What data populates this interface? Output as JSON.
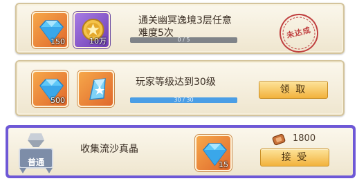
{
  "tasks": [
    {
      "title": "通关幽冥逸境3层任意难度5次",
      "progress_text": "0 / 5",
      "progress_fraction": 0.0,
      "rewards": [
        {
          "icon": "diamond-icon",
          "qty": "150"
        },
        {
          "icon": "gold-coin-icon",
          "qty": "10万"
        }
      ],
      "status": "未达成"
    },
    {
      "title": "玩家等级达到30级",
      "progress_text": "30 / 30",
      "progress_fraction": 1.0,
      "rewards": [
        {
          "icon": "diamond-icon",
          "qty": "500"
        },
        {
          "icon": "crystal-shard-icon",
          "qty": ""
        }
      ],
      "button_label": "领 取"
    },
    {
      "badge": "普通",
      "title": "收集流沙真晶",
      "rewards": [
        {
          "icon": "diamond-icon",
          "qty": "15"
        }
      ],
      "cost": "1800",
      "cost_icon": "bronze-coin-icon",
      "button_label": "接 受"
    }
  ],
  "colors": {
    "card_border": "#d4c49c",
    "highlight_border": "#6e58d6",
    "button": "#f2b23d",
    "progress_fill": "#4a9ee6",
    "stamp": "#c04040"
  }
}
